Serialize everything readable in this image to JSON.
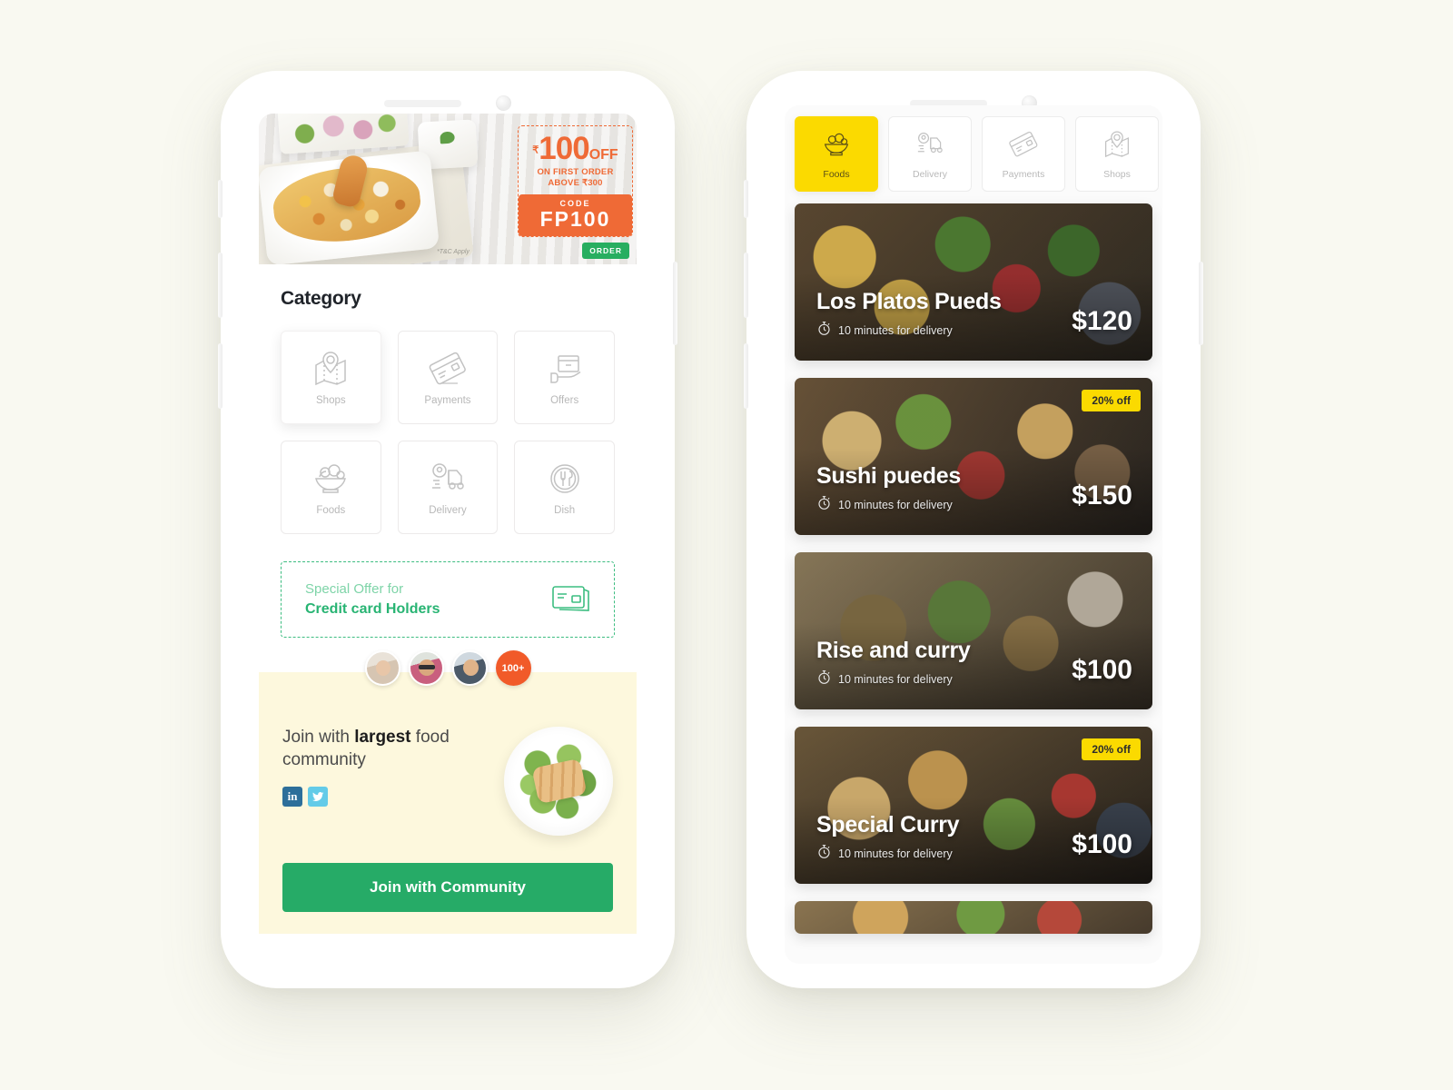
{
  "background_color": "#f9f9f1",
  "accent": {
    "green": "#26ab67",
    "orange": "#ef6a36",
    "yellow": "#fbda00",
    "teal_green": "#28b473"
  },
  "left_phone": {
    "promo_banner": {
      "currency_symbol": "₹",
      "amount": "100",
      "off_label": "OFF",
      "condition_line1": "ON FIRST ORDER",
      "condition_line2_prefix": "ABOVE ",
      "condition_line2_amount": "₹300",
      "code_label": "CODE",
      "code_value": "FP100",
      "terms": "*T&C Apply",
      "order_button": "ORDER"
    },
    "category": {
      "title": "Category",
      "items": [
        {
          "label": "Shops",
          "icon": "map-pin-icon",
          "selected": true
        },
        {
          "label": "Payments",
          "icon": "credit-card-icon",
          "selected": false
        },
        {
          "label": "Offers",
          "icon": "package-hand-icon",
          "selected": false
        },
        {
          "label": "Foods",
          "icon": "food-bowl-icon",
          "selected": false
        },
        {
          "label": "Delivery",
          "icon": "delivery-truck-icon",
          "selected": false
        },
        {
          "label": "Dish",
          "icon": "plate-cutlery-icon",
          "selected": false
        }
      ]
    },
    "special_offer": {
      "line1": "Special Offer for",
      "line2": "Credit card Holders",
      "icon": "credit-cards-icon"
    },
    "community": {
      "avatar_overflow": "100+",
      "headline_part1": "Join with ",
      "headline_bold": "largest",
      "headline_part2": " food community",
      "socials": [
        {
          "name": "linkedin-icon",
          "glyph": "in"
        },
        {
          "name": "twitter-icon",
          "glyph": ""
        }
      ],
      "cta_label": "Join with Community"
    }
  },
  "right_phone": {
    "tabs": [
      {
        "label": "Foods",
        "icon": "food-bowl-icon",
        "active": true
      },
      {
        "label": "Delivery",
        "icon": "delivery-truck-icon",
        "active": false
      },
      {
        "label": "Payments",
        "icon": "credit-card-icon",
        "active": false
      },
      {
        "label": "Shops",
        "icon": "map-pin-icon",
        "active": false
      },
      {
        "label": "",
        "icon": "map-pin-icon",
        "active": false
      }
    ],
    "food_cards": [
      {
        "name": "Los Platos Pueds",
        "delivery_time": "10 minutes for delivery",
        "price": "$120",
        "badge": null
      },
      {
        "name": "Sushi puedes",
        "delivery_time": "10 minutes for delivery",
        "price": "$150",
        "badge": "20% off"
      },
      {
        "name": "Rise and curry",
        "delivery_time": "10 minutes for delivery",
        "price": "$100",
        "badge": null
      },
      {
        "name": "Special Curry",
        "delivery_time": "10 minutes for delivery",
        "price": "$100",
        "badge": "20% off"
      }
    ]
  }
}
